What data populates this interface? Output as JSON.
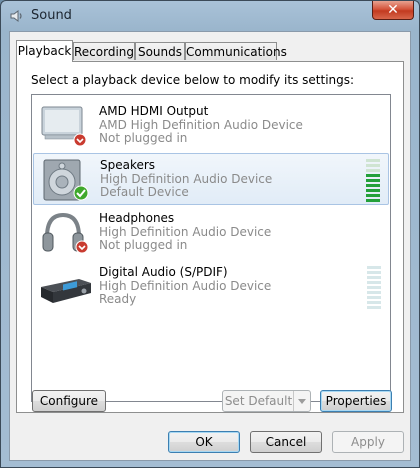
{
  "window": {
    "title": "Sound",
    "close_label": "✕"
  },
  "tabs": [
    {
      "label": "Playback",
      "active": true
    },
    {
      "label": "Recording",
      "active": false
    },
    {
      "label": "Sounds",
      "active": false
    },
    {
      "label": "Communications",
      "active": false
    }
  ],
  "instruction": "Select a playback device below to modify its settings:",
  "devices": [
    {
      "name": "AMD HDMI Output",
      "description": "AMD High Definition Audio Device",
      "status": "Not plugged in",
      "icon": "monitor-icon",
      "badge": "unplugged-badge-icon",
      "selected": false,
      "meter_level": null
    },
    {
      "name": "Speakers",
      "description": "High Definition Audio Device",
      "status": "Default Device",
      "icon": "speaker-icon",
      "badge": "default-check-icon",
      "selected": true,
      "meter_level": 0.6
    },
    {
      "name": "Headphones",
      "description": "High Definition Audio Device",
      "status": "Not plugged in",
      "icon": "headphones-icon",
      "badge": "unplugged-badge-icon",
      "selected": false,
      "meter_level": null
    },
    {
      "name": "Digital Audio (S/PDIF)",
      "description": "High Definition Audio Device",
      "status": "Ready",
      "icon": "spdif-receiver-icon",
      "badge": null,
      "selected": false,
      "meter_level": 0
    }
  ],
  "buttons": {
    "configure": "Configure",
    "set_default": "Set Default",
    "properties": "Properties",
    "ok": "OK",
    "cancel": "Cancel",
    "apply": "Apply"
  }
}
